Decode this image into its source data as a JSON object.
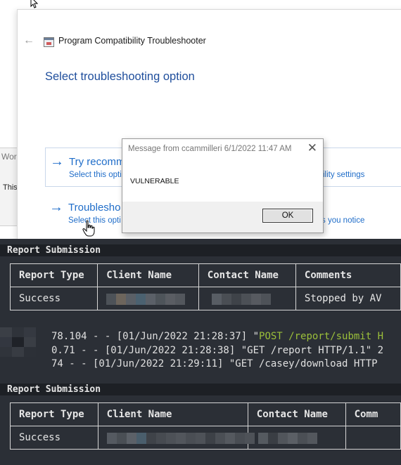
{
  "background_window": {
    "title_fragment": "Wor",
    "text_fragment": "This"
  },
  "main_window": {
    "title": "Program Compatibility Troubleshooter",
    "heading": "Select troubleshooting option",
    "options": [
      {
        "title": "Try recomm",
        "subtitle": "Select this opti",
        "subtitle_right": "ility settings"
      },
      {
        "title": "Troublesho",
        "subtitle": "Select this opti",
        "subtitle_right": "s you notice"
      }
    ]
  },
  "message_dialog": {
    "title": "Message from ccammilleri 6/1/2022 11:47 AM",
    "body": "VULNERABLE",
    "ok_label": "OK"
  },
  "terminal": {
    "section_title": "Report Submission",
    "table1": {
      "headers": [
        "Report Type",
        "Client Name",
        "Contact Name",
        "Comments"
      ],
      "row": {
        "report_type": "Success",
        "comments": "Stopped by AV"
      }
    },
    "log_lines": [
      {
        "prefix": "78.104 - - [01/Jun/2022 21:28:37] \"",
        "request": "POST /report/submit H"
      },
      {
        "prefix": "0.71 - - [01/Jun/2022 21:28:38] \"GET /report HTTP/1.1\" 2",
        "request": ""
      },
      {
        "prefix": "74 - - [01/Jun/2022 21:29:11] \"GET /casey/download HTTP",
        "request": ""
      }
    ],
    "section_title_2": "Report Submission",
    "table2": {
      "headers": [
        "Report Type",
        "Client Name",
        "Contact Name",
        "Comm"
      ],
      "row": {
        "report_type": "Success"
      }
    }
  },
  "colors": {
    "accent_blue": "#1f6dc9",
    "heading_blue": "#1f4e9c",
    "terminal_bg": "#2b2f36",
    "log_post_green": "#9bbf3a"
  },
  "icons": {
    "back": "back-arrow-icon",
    "app": "troubleshooter-app-icon",
    "close": "close-icon",
    "option_arrow": "right-arrow-icon",
    "cursor": "mouse-pointer-icon",
    "hand": "hand-cursor-icon"
  }
}
